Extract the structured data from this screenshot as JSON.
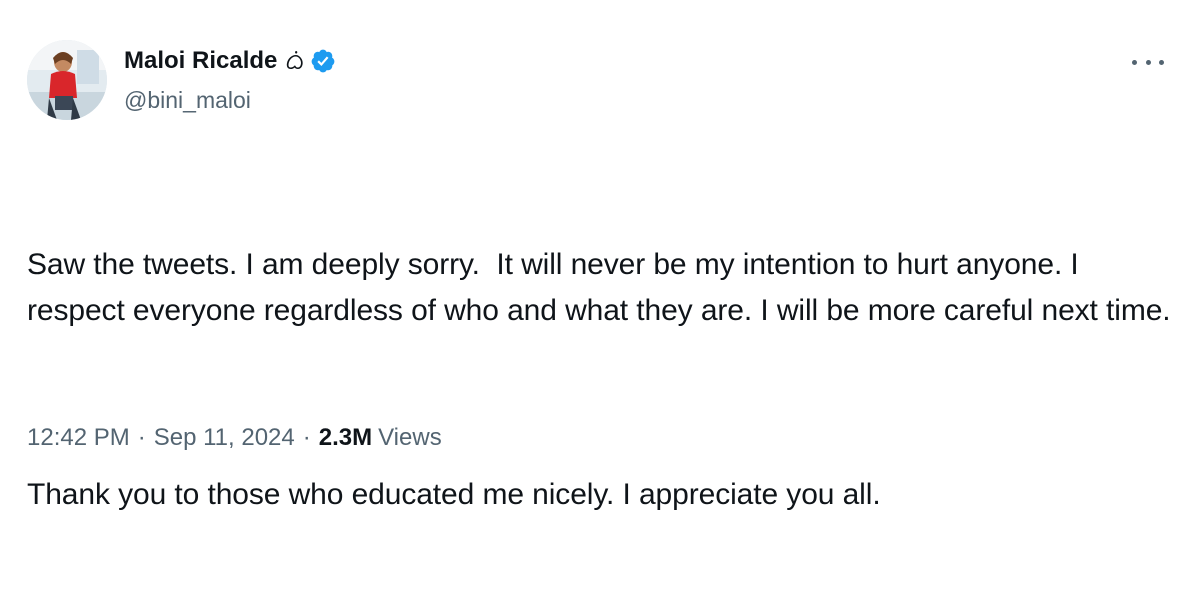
{
  "tweet": {
    "author": {
      "display_name": "Maloi Ricalde",
      "name_suffix": "ᜊᜒ",
      "handle": "@bini_maloi",
      "verified": true,
      "verified_icon": "verified-badge-icon",
      "avatar_icon": "avatar-photo"
    },
    "more_icon": "more-options-icon",
    "paragraphs": [
      "Saw the tweets. I am deeply sorry.  It will never be my intention to hurt anyone. I respect everyone regardless of who and what they are. I will be more careful next time.",
      "Thank you to those who educated me nicely. I appreciate you all."
    ],
    "time": "12:42 PM",
    "date": "Sep 11, 2024",
    "separator": "·",
    "views_count": "2.3M",
    "views_label": "Views"
  },
  "colors": {
    "text_primary": "#0f1419",
    "text_secondary": "#536471",
    "verified_blue": "#1d9bf0"
  }
}
